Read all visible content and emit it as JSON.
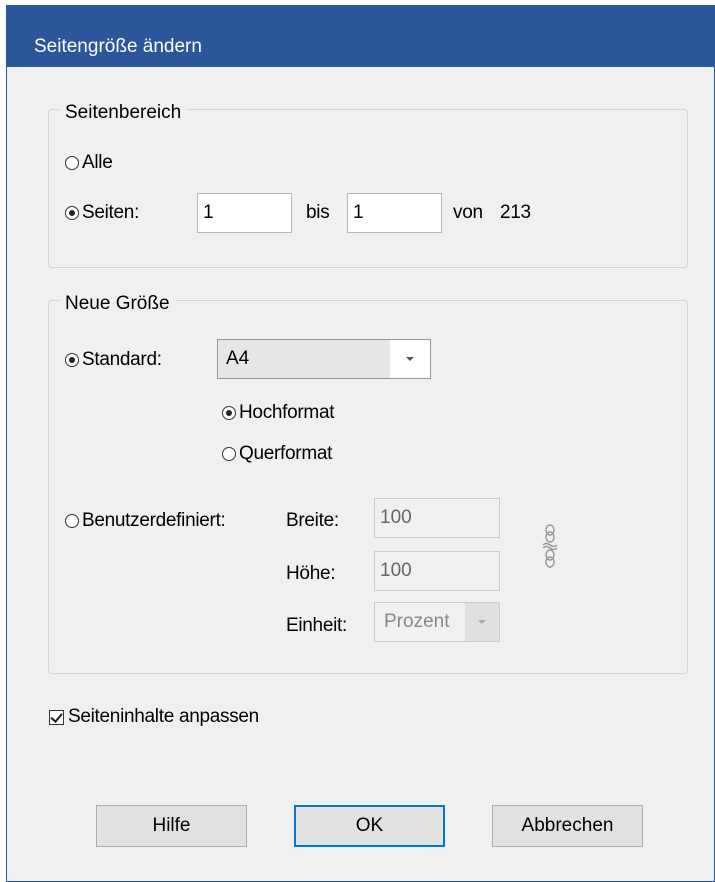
{
  "window": {
    "title": "Seitengröße ändern"
  },
  "page_range": {
    "legend": "Seitenbereich",
    "all_label": "Alle",
    "pages_label": "Seiten:",
    "from_value": "1",
    "to_label": "bis",
    "to_value": "1",
    "of_label": "von",
    "total": "213"
  },
  "new_size": {
    "legend": "Neue Größe",
    "standard_label": "Standard:",
    "standard_value": "A4",
    "portrait_label": "Hochformat",
    "landscape_label": "Querformat",
    "custom_label": "Benutzerdefiniert:",
    "width_label": "Breite:",
    "width_value": "100",
    "height_label": "Höhe:",
    "height_value": "100",
    "unit_label": "Einheit:",
    "unit_value": "Prozent"
  },
  "fit_content": {
    "label": "Seiteninhalte anpassen",
    "checked": true
  },
  "buttons": {
    "help": "Hilfe",
    "ok": "OK",
    "cancel": "Abbrechen"
  },
  "colors": {
    "titlebar": "#2b579a",
    "default_button_border": "#0078d7",
    "dialog_bg": "#f0f0f0"
  },
  "icons": {
    "link_toggle": "chain-link-icon"
  }
}
